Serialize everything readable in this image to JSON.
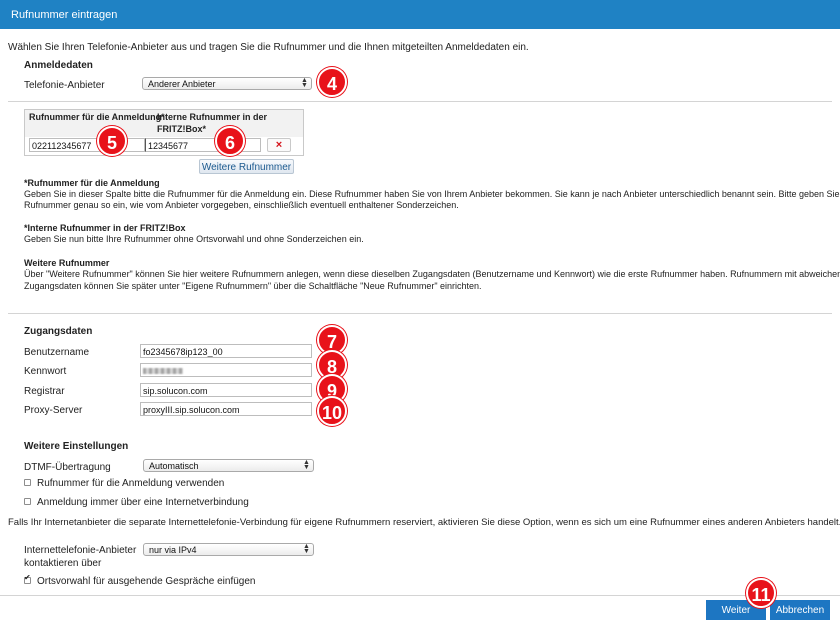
{
  "window": {
    "title": "Rufnummer eintragen"
  },
  "intro": "Wählen Sie Ihren Telefonie-Anbieter aus und tragen Sie die Rufnummer und die Ihnen mitgeteilten Anmeldedaten ein.",
  "anmeldedaten": {
    "heading": "Anmeldedaten",
    "provider_label": "Telefonie-Anbieter",
    "provider_value": "Anderer Anbieter"
  },
  "numbers_table": {
    "col1": "Rufnummer für die Anmeldung*",
    "col2_line1": "Interne Rufnummer in der",
    "col2_line2": "FRITZ!Box*",
    "row": {
      "login_number": "022112345677",
      "internal_number": "12345677",
      "delete_symbol": "×"
    },
    "add_button": "Weitere Rufnummer"
  },
  "help": {
    "h1": "*Rufnummer für die Anmeldung",
    "p1_line1": "Geben Sie in dieser Spalte bitte die Rufnummer für die Anmeldung ein. Diese Rufnummer haben Sie von Ihrem Anbieter bekommen. Sie kann je nach Anbieter unterschiedlich benannt sein. Bitte geben Sie die",
    "p1_line2": "Rufnummer genau so ein, wie vom Anbieter vorgegeben, einschließlich eventuell enthaltener Sonderzeichen.",
    "h2": "*Interne Rufnummer in der FRITZ!Box",
    "p2": "Geben Sie nun bitte Ihre Rufnummer ohne Ortsvorwahl und ohne Sonderzeichen ein.",
    "h3": "Weitere Rufnummer",
    "p3_line1": "Über \"Weitere Rufnummer\" können Sie hier weitere Rufnummern anlegen, wenn diese dieselben Zugangsdaten (Benutzername und Kennwort) wie die erste Rufnummer haben. Rufnummern mit abweichenden",
    "p3_line2": "Zugangsdaten können Sie später unter \"Eigene Rufnummern\" über die Schaltfläche \"Neue Rufnummer\" einrichten."
  },
  "zugangsdaten": {
    "heading": "Zugangsdaten",
    "username_label": "Benutzername",
    "username_value": "fo2345678ip123_00",
    "password_label": "Kennwort",
    "registrar_label": "Registrar",
    "registrar_value": "sip.solucon.com",
    "proxy_label": "Proxy-Server",
    "proxy_value": "proxyIII.sip.solucon.com"
  },
  "weitere": {
    "heading": "Weitere Einstellungen",
    "dtmf_label": "DTMF-Übertragung",
    "dtmf_value": "Automatisch",
    "cb1_label": "Rufnummer für die Anmeldung verwenden",
    "cb2_label": "Anmeldung immer über eine Internetverbindung",
    "note": "Falls Ihr Internetanbieter die separate Internettelefonie-Verbindung für eigene Rufnummern reserviert, aktivieren Sie diese Option, wenn es sich um eine Rufnummer eines anderen Anbieters handelt.",
    "contact_label_line1": "Internettelefonie-Anbieter",
    "contact_label_line2": "kontaktieren über",
    "contact_value": "nur via IPv4",
    "cb3_label": "Ortsvorwahl für ausgehende Gespräche einfügen"
  },
  "footer": {
    "next": "Weiter",
    "cancel": "Abbrechen"
  },
  "annotations": {
    "b4": "4",
    "b5": "5",
    "b6": "6",
    "b7": "7",
    "b8": "8",
    "b9": "9",
    "b10": "10",
    "b11": "11"
  },
  "colors": {
    "titlebar": "#1f82c4",
    "primary_button": "#1d76c2",
    "badge": "#e8121a"
  }
}
